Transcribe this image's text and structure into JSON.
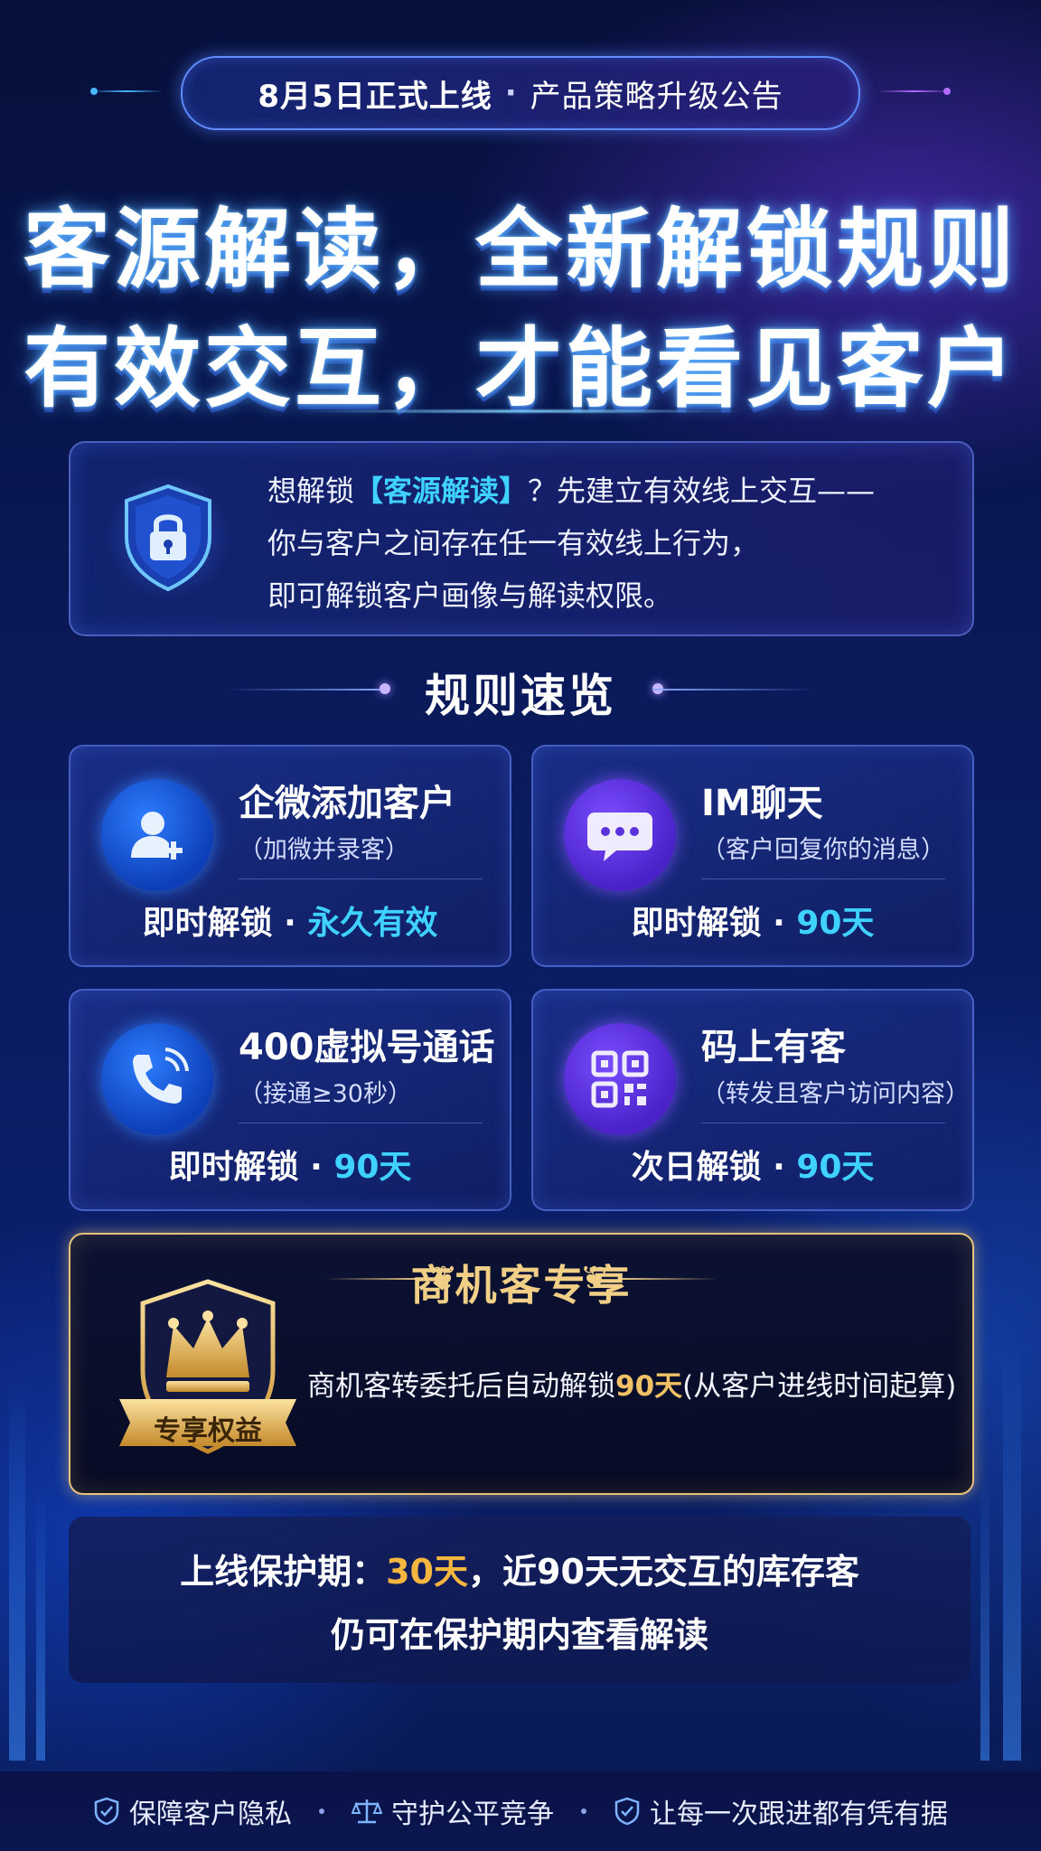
{
  "announcement": {
    "date_label": "8月5日正式上线",
    "separator": "·",
    "subtitle": "产品策略升级公告"
  },
  "hero": {
    "line1": "客源解读，全新解锁规则",
    "line2": "有效交互，才能看见客户"
  },
  "intro": {
    "icon": "shield-lock-icon",
    "line1_prefix": "想解锁",
    "line1_highlight": "【客源解读】",
    "line1_suffix": "？先建立有效线上交互——",
    "line2": "你与客户之间存在任一有效线上行为，",
    "line3": "即可解锁客户画像与解读权限。"
  },
  "rules_section": {
    "title": "规则速览",
    "rules": [
      {
        "title": "企微添加客户",
        "subtitle": "（加微并录客）",
        "unlock_prefix": "即时解锁 · ",
        "unlock_value": "永久有效",
        "icon": "add-user-icon",
        "icon_color": "#1f5fe6"
      },
      {
        "title": "IM聊天",
        "subtitle": "（客户回复你的消息）",
        "unlock_prefix": "即时解锁 · ",
        "unlock_value": "90天",
        "icon": "chat-bubble-icon",
        "icon_color": "#5b31d9"
      },
      {
        "title": "400虚拟号通话",
        "subtitle": "（接通≥30秒）",
        "unlock_prefix": "即时解锁 · ",
        "unlock_value": "90天",
        "icon": "phone-icon",
        "icon_color": "#1f5fe6"
      },
      {
        "title": "码上有客",
        "subtitle": "（转发且客户访问内容）",
        "unlock_prefix": "次日解锁 · ",
        "unlock_value": "90天",
        "icon": "qr-code-icon",
        "icon_color": "#5b31d9"
      }
    ]
  },
  "exclusive": {
    "title": "商机客专享",
    "badge": "专享权益",
    "badge_icon": "crown-icon",
    "text_prefix": "商机客转委托后自动解锁",
    "text_highlight": "90天",
    "text_suffix": "(从客户进线时间起算)",
    "accent_color": "#f1c265"
  },
  "protection": {
    "line1_prefix": "上线保护期：",
    "line1_highlight": "30天",
    "line1_suffix": "，近90天无交互的库存客",
    "line2": "仍可在保护期内查看解读",
    "accent_color": "#f5b640"
  },
  "footer": {
    "items": [
      {
        "label": "保障客户隐私",
        "icon": "shield-check-icon"
      },
      {
        "label": "守护公平竞争",
        "icon": "scale-icon"
      },
      {
        "label": "让每一次跟进都有凭有据",
        "icon": "shield-check-icon"
      }
    ]
  },
  "colors": {
    "accent_cyan": "#3fd2ff",
    "gold": "#f1c265",
    "background": "#0a1a5c"
  }
}
